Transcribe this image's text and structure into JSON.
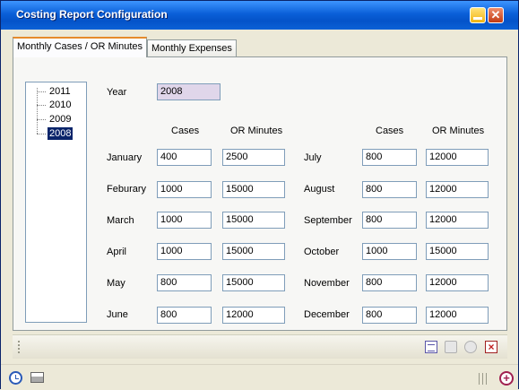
{
  "window": {
    "title": "Costing Report Configuration",
    "close_glyph": "✕"
  },
  "tabs": [
    {
      "label": "Monthly Cases / OR Minutes",
      "active": true
    },
    {
      "label": "Monthly Expenses",
      "active": false
    }
  ],
  "year_tree": {
    "items": [
      "2011",
      "2010",
      "2009",
      "2008"
    ],
    "selected": "2008"
  },
  "year": {
    "label": "Year",
    "value": "2008"
  },
  "headers": {
    "cases": "Cases",
    "or_minutes": "OR Minutes"
  },
  "months_left": [
    {
      "month": "January",
      "cases": "400",
      "or_minutes": "2500"
    },
    {
      "month": "Feburary",
      "cases": "1000",
      "or_minutes": "15000"
    },
    {
      "month": "March",
      "cases": "1000",
      "or_minutes": "15000"
    },
    {
      "month": "April",
      "cases": "1000",
      "or_minutes": "15000"
    },
    {
      "month": "May",
      "cases": "800",
      "or_minutes": "15000"
    },
    {
      "month": "June",
      "cases": "800",
      "or_minutes": "12000"
    }
  ],
  "months_right": [
    {
      "month": "July",
      "cases": "800",
      "or_minutes": "12000"
    },
    {
      "month": "August",
      "cases": "800",
      "or_minutes": "12000"
    },
    {
      "month": "September",
      "cases": "800",
      "or_minutes": "12000"
    },
    {
      "month": "October",
      "cases": "1000",
      "or_minutes": "15000"
    },
    {
      "month": "November",
      "cases": "800",
      "or_minutes": "12000"
    },
    {
      "month": "December",
      "cases": "800",
      "or_minutes": "12000"
    }
  ],
  "toolbar_icons": [
    "document-icon",
    "copy-icon",
    "ok-icon",
    "delete-icon"
  ],
  "status_icons": [
    "clock-icon",
    "print-icon",
    "resize-grip",
    "add-icon"
  ],
  "colors": {
    "titlebar": "#0453c9",
    "selection": "#0a246a",
    "year_field": "#e0d6ea"
  }
}
